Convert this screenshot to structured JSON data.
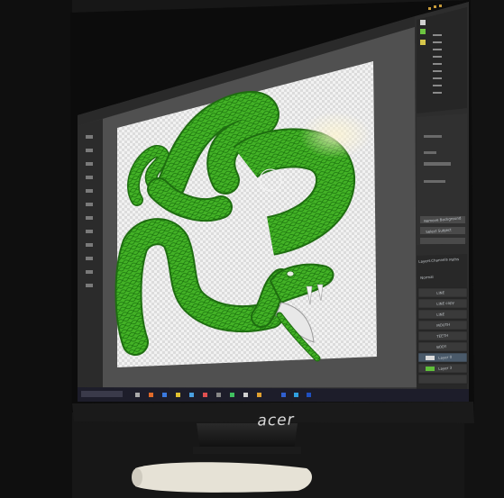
{
  "monitor": {
    "brand_logo": "acer"
  },
  "photoshop": {
    "right_panel_labels": {
      "remove_background": "Remove Background",
      "select_subject": "Select Subject",
      "layers_tab": "Layers",
      "channels_tab": "Channels",
      "paths_tab": "Paths",
      "normal_mode": "Normal",
      "layers": [
        "LINE",
        "LINE copy",
        "LINE",
        "MOUTH",
        "TEETH",
        "BODY",
        "Layer 0",
        "Layer 3"
      ]
    }
  },
  "colors": {
    "snake_green": "#3fae25",
    "snake_dark": "#1e6d10",
    "ps_panel": "#2b2b2b",
    "ps_canvas_bg": "#535353"
  }
}
